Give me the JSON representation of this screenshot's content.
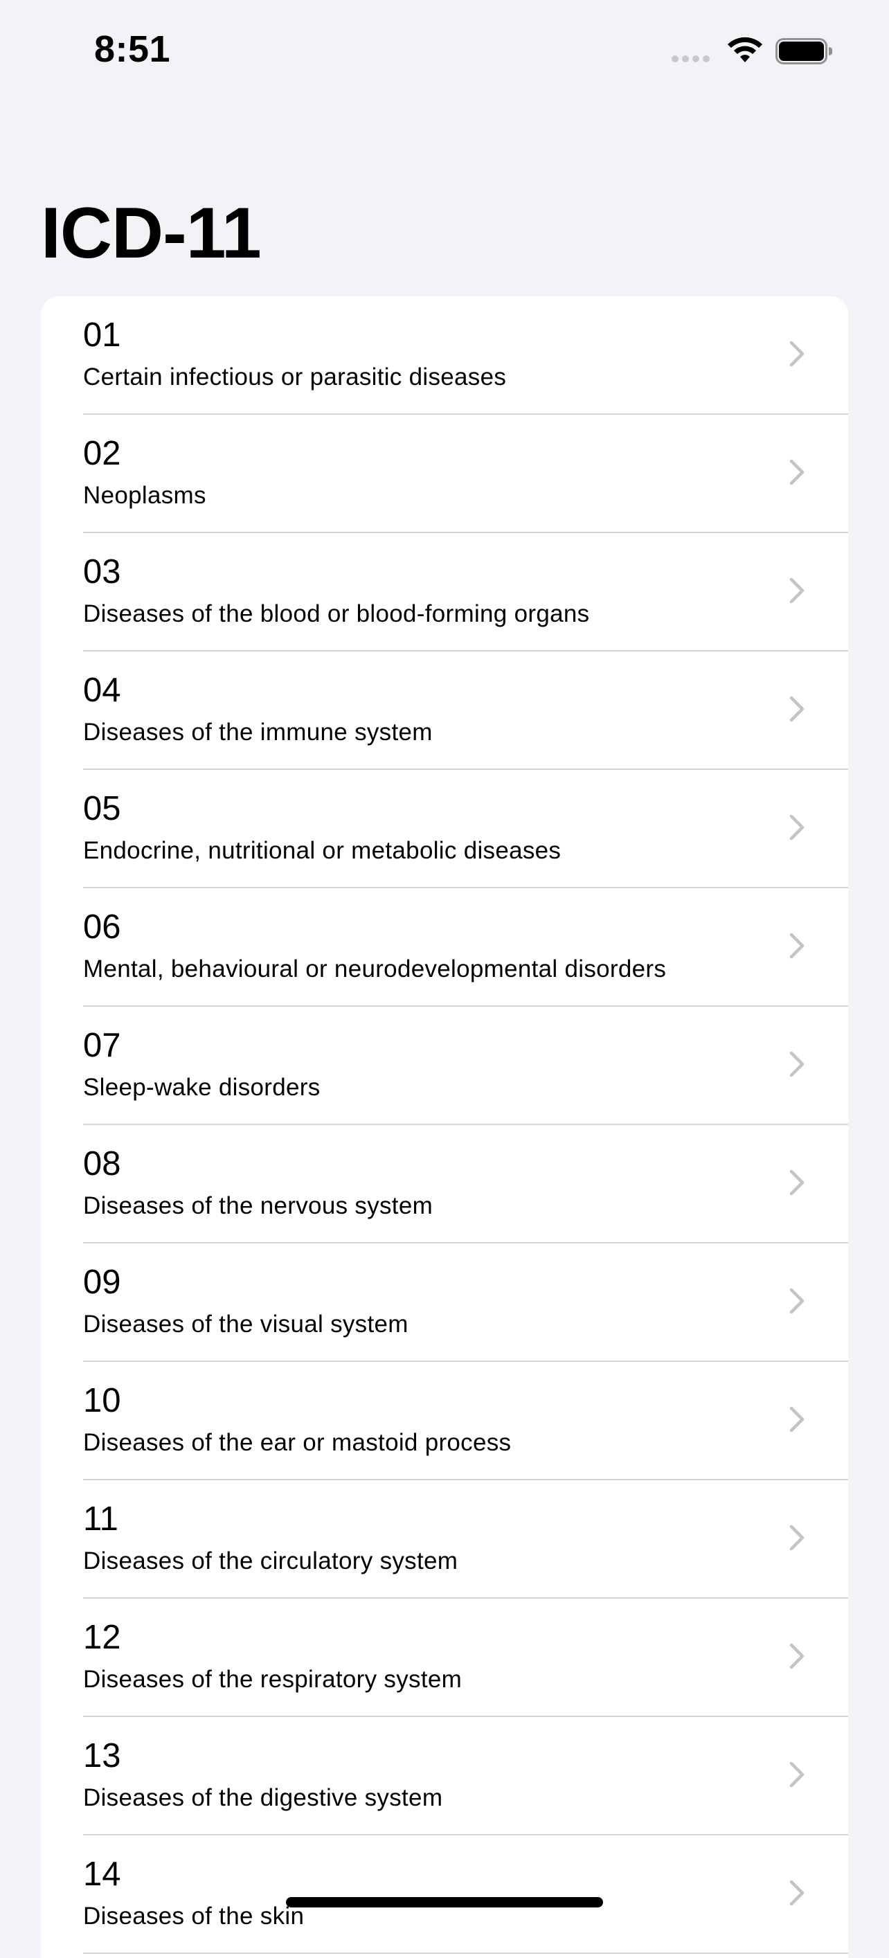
{
  "status_bar": {
    "time": "8:51"
  },
  "header": {
    "title": "ICD-11"
  },
  "chapters": [
    {
      "code": "01",
      "title": "Certain infectious or parasitic diseases"
    },
    {
      "code": "02",
      "title": "Neoplasms"
    },
    {
      "code": "03",
      "title": "Diseases of the blood or blood-forming organs"
    },
    {
      "code": "04",
      "title": "Diseases of the immune system"
    },
    {
      "code": "05",
      "title": "Endocrine, nutritional or metabolic diseases"
    },
    {
      "code": "06",
      "title": "Mental, behavioural or neurodevelopmental disorders"
    },
    {
      "code": "07",
      "title": "Sleep-wake disorders"
    },
    {
      "code": "08",
      "title": "Diseases of the nervous system"
    },
    {
      "code": "09",
      "title": "Diseases of the visual system"
    },
    {
      "code": "10",
      "title": "Diseases of the ear or mastoid process"
    },
    {
      "code": "11",
      "title": "Diseases of the circulatory system"
    },
    {
      "code": "12",
      "title": "Diseases of the respiratory system"
    },
    {
      "code": "13",
      "title": "Diseases of the digestive system"
    },
    {
      "code": "14",
      "title": "Diseases of the skin"
    }
  ],
  "icons": {
    "row_accessory": "chevron-right-icon",
    "wifi": "wifi-icon",
    "battery": "battery-icon",
    "signal": "signal-dots-icon"
  },
  "colors": {
    "background": "#f2f2f7",
    "card": "#ffffff",
    "separator": "#d6d6da",
    "chevron": "#c4c4c7"
  }
}
